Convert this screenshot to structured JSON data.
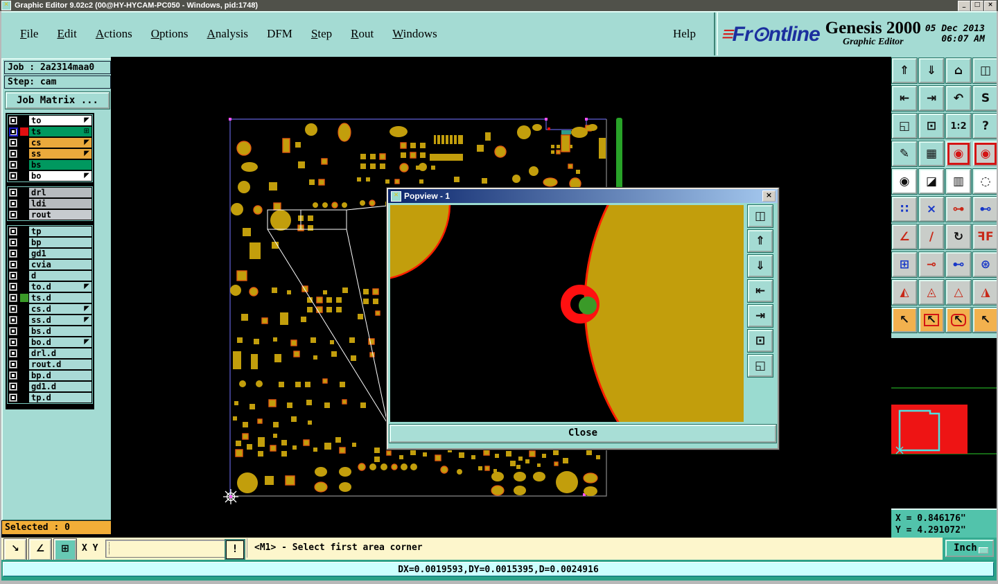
{
  "window": {
    "title": "Graphic Editor 9.02c2 (00@HY-HYCAM-PC050 - Windows, pid:1748)",
    "controls": {
      "minimize": "_",
      "maximize": "□",
      "close": "×"
    }
  },
  "menu": {
    "items": [
      {
        "label": "File",
        "u": true
      },
      {
        "label": "Edit",
        "u": true
      },
      {
        "label": "Actions",
        "u": true
      },
      {
        "label": "Options",
        "u": true
      },
      {
        "label": "Analysis",
        "u": true
      },
      {
        "label": "DFM",
        "u": false
      },
      {
        "label": "Step",
        "u": true
      },
      {
        "label": "Rout",
        "u": true
      },
      {
        "label": "Windows",
        "u": true
      }
    ],
    "help_label": "Help"
  },
  "branding": {
    "logo_text": "Frontline",
    "product": "Genesis 2000",
    "subtitle": "Graphic Editor",
    "date": "05 Dec 2013",
    "time": "06:07 AM"
  },
  "job_panel": {
    "job_line": "Job : 2a2314maa0",
    "step_line": "Step: cam",
    "matrix_button": "Job Matrix ..."
  },
  "layers": {
    "groups": [
      {
        "items": [
          {
            "name": "to",
            "bg": "#ffffff",
            "arrow": true
          },
          {
            "name": "ts",
            "bg": "#00985f",
            "swatch": "#e01010",
            "active": true,
            "icon": "grid"
          },
          {
            "name": "cs",
            "bg": "#eaa93c",
            "arrow": true
          },
          {
            "name": "ss",
            "bg": "#eaa93c",
            "arrow": true
          },
          {
            "name": "bs",
            "bg": "#00985f"
          },
          {
            "name": "bo",
            "bg": "#ffffff",
            "arrow": true
          }
        ]
      },
      {
        "items": [
          {
            "name": "drl",
            "bg": "#b7bbbf"
          },
          {
            "name": "ldi",
            "bg": "#b7bbbf"
          },
          {
            "name": "rout",
            "bg": "#c7cbcf"
          }
        ]
      },
      {
        "items": [
          {
            "name": "tp",
            "bg": "#a9dad6"
          },
          {
            "name": "bp",
            "bg": "#a9dad6"
          },
          {
            "name": "gd1",
            "bg": "#a9dad6"
          },
          {
            "name": "cvia",
            "bg": "#a9dad6"
          },
          {
            "name": "d",
            "bg": "#a9dad6"
          },
          {
            "name": "to.d",
            "bg": "#a9dad6",
            "arrow": true
          },
          {
            "name": "ts.d",
            "bg": "#a9dad6",
            "swatch": "#3a9a28"
          },
          {
            "name": "cs.d",
            "bg": "#a9dad6",
            "arrow": true
          },
          {
            "name": "ss.d",
            "bg": "#a9dad6",
            "arrow": true
          },
          {
            "name": "bs.d",
            "bg": "#a9dad6"
          },
          {
            "name": "bo.d",
            "bg": "#a9dad6",
            "arrow": true
          },
          {
            "name": "drl.d",
            "bg": "#a9dad6"
          },
          {
            "name": "rout.d",
            "bg": "#a9dad6"
          },
          {
            "name": "bp.d",
            "bg": "#a9dad6"
          },
          {
            "name": "gd1.d",
            "bg": "#a9dad6"
          },
          {
            "name": "tp.d",
            "bg": "#a9dad6"
          }
        ]
      }
    ]
  },
  "toolbar_right": {
    "buttons": [
      {
        "name": "zoom-in",
        "style": "teal"
      },
      {
        "name": "zoom-out",
        "style": "teal"
      },
      {
        "name": "home-view",
        "style": "teal"
      },
      {
        "name": "windows-xy",
        "style": "teal"
      },
      {
        "name": "pan-left",
        "style": "teal"
      },
      {
        "name": "pan-right",
        "style": "teal"
      },
      {
        "name": "previous-view",
        "style": "teal"
      },
      {
        "name": "route-s",
        "style": "teal"
      },
      {
        "name": "fit-window",
        "style": "teal"
      },
      {
        "name": "center-view",
        "style": "teal"
      },
      {
        "name": "scale-1-2",
        "style": "teal"
      },
      {
        "name": "help-q",
        "style": "teal"
      },
      {
        "name": "setup-tools",
        "style": "teal"
      },
      {
        "name": "grid-toggle",
        "style": "teal"
      },
      {
        "name": "netlist-a",
        "style": "red",
        "color": "#d41414"
      },
      {
        "name": "netlist-b",
        "style": "red",
        "color": "#d41414"
      },
      {
        "name": "select-feature",
        "style": "white"
      },
      {
        "name": "swap-layers",
        "style": "white"
      },
      {
        "name": "measure-ruler",
        "style": "white"
      },
      {
        "name": "select-circle",
        "style": "white"
      },
      {
        "name": "connect-dots",
        "style": "gray",
        "color": "#1838c8"
      },
      {
        "name": "delete-x",
        "style": "gray",
        "color": "#1838c8"
      },
      {
        "name": "move-point",
        "style": "gray",
        "color": "#c82818"
      },
      {
        "name": "copy-point",
        "style": "gray",
        "color": "#1838c8"
      },
      {
        "name": "measure-angle",
        "style": "gray",
        "color": "#c82818"
      },
      {
        "name": "slant-line",
        "style": "gray",
        "color": "#c82818"
      },
      {
        "name": "rotate-90",
        "style": "gray"
      },
      {
        "name": "mirror-ff",
        "style": "gray",
        "color": "#c82818"
      },
      {
        "name": "copy-pad",
        "style": "gray",
        "color": "#1838c8"
      },
      {
        "name": "fatten-line",
        "style": "gray",
        "color": "#c82818"
      },
      {
        "name": "measure-gap",
        "style": "gray",
        "color": "#1838c8"
      },
      {
        "name": "merge-shapes",
        "style": "gray",
        "color": "#1838c8"
      },
      {
        "name": "tri-outline",
        "style": "gray",
        "color": "#c82818"
      },
      {
        "name": "tri-tall",
        "style": "gray",
        "color": "#c82818"
      },
      {
        "name": "tri-base",
        "style": "gray",
        "color": "#c82818"
      },
      {
        "name": "tri-wide",
        "style": "gray",
        "color": "#c82818"
      },
      {
        "name": "select-cursor",
        "style": "orange"
      },
      {
        "name": "select-frame",
        "style": "orange"
      },
      {
        "name": "select-polygon",
        "style": "orange"
      },
      {
        "name": "select-net",
        "style": "orange"
      }
    ]
  },
  "popview": {
    "title": "Popview - 1",
    "close_x": "×",
    "close_button": "Close",
    "side_buttons": [
      "clone-view",
      "zoom-in",
      "zoom-out",
      "pan-left",
      "pan-right",
      "center-view",
      "fit-window"
    ]
  },
  "coords": {
    "x_text": "X = 0.846176\"",
    "y_text": "Y = 4.291072\""
  },
  "bottom_bar": {
    "selected_text": "Selected : 0",
    "mini_buttons": [
      "measure-distance",
      "measure-angle2",
      "grid-window"
    ],
    "xy_label": "X Y :",
    "input_value": "",
    "alert_button": "!",
    "message": "<M1> - Select first area corner",
    "units": "Inch"
  },
  "status_bar": {
    "text": "DX=0.0019593,DY=0.0015395,D=0.0024916"
  },
  "colors": {
    "panel_teal": "#a4dbd3",
    "pad_gold": "#c29e0c",
    "pad_outline": "#e35b12",
    "board_blue": "#6060d8",
    "board_gray": "#8a8a8a",
    "green_bar": "#28a228",
    "ring_red": "#ff1010",
    "drill_green": "#3a9a28",
    "minimap_red": "#ee1414",
    "minimap_cyan": "#50e0e0",
    "selected_orange": "#f2ae38",
    "status_cyan": "#ccffff"
  }
}
